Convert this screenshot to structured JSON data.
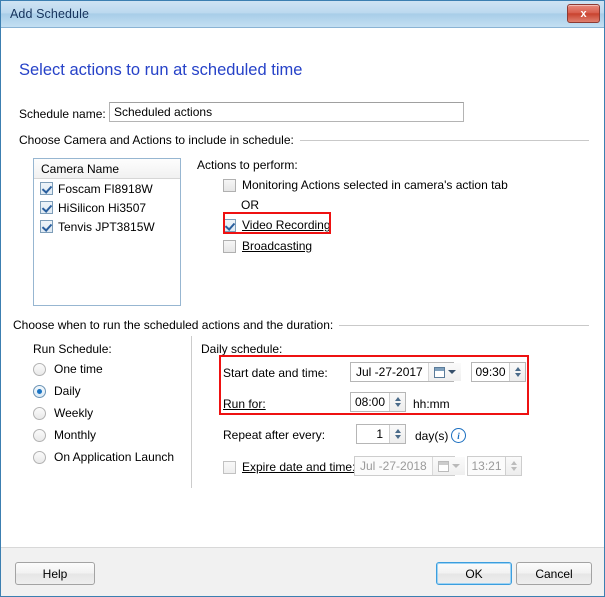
{
  "window": {
    "title": "Add Schedule",
    "close_label": "x",
    "heading": "Select actions to run at scheduled time"
  },
  "schedule_name": {
    "label": "Schedule name:",
    "value": "Scheduled actions",
    "placeholder": ""
  },
  "camera_group": {
    "caption": "Choose Camera and Actions to include in schedule:",
    "list_header": "Camera Name",
    "cameras": [
      {
        "label": "Foscam FI8918W",
        "checked": true
      },
      {
        "label": "HiSilicon Hi3507",
        "checked": true
      },
      {
        "label": "Tenvis JPT3815W",
        "checked": true
      }
    ],
    "actions_title": "Actions to perform:",
    "or_text": "OR",
    "actions": [
      {
        "label": "Monitoring Actions selected in camera's action tab",
        "checked": false,
        "highlighted": false
      },
      {
        "label": "Video Recording",
        "checked": true,
        "highlighted": true
      },
      {
        "label": "Broadcasting",
        "checked": false,
        "highlighted": false
      }
    ]
  },
  "when_group": {
    "caption": "Choose when to run the scheduled actions and the duration:",
    "run_schedule_label": "Run Schedule:",
    "run_schedule_options": [
      {
        "label": "One time",
        "selected": false
      },
      {
        "label": "Daily",
        "selected": true
      },
      {
        "label": "Weekly",
        "selected": false
      },
      {
        "label": "Monthly",
        "selected": false
      },
      {
        "label": "On Application Launch",
        "selected": false
      }
    ],
    "daily_label": "Daily schedule:",
    "start": {
      "label": "Start date and time:",
      "date": "Jul -27-2017",
      "time": "09:30"
    },
    "run_for": {
      "label": "Run for:",
      "value": "08:00",
      "suffix": "hh:mm"
    },
    "repeat": {
      "label": "Repeat after every:",
      "value": "1",
      "suffix": "day(s)",
      "info_icon": "info-icon"
    },
    "expire": {
      "label": "Expire date and time:",
      "checked": false,
      "date": "Jul -27-2018",
      "time": "13:21",
      "enabled": false
    }
  },
  "footer": {
    "help_label": "Help",
    "ok_label": "OK",
    "cancel_label": "Cancel"
  },
  "colors": {
    "accent_blue": "#2642c8",
    "highlight_red": "#ee1111",
    "titlebar_blue": "#a8cde8"
  }
}
